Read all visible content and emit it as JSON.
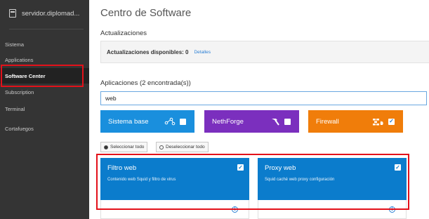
{
  "sidebar": {
    "host_name": "servidor.diplomad...",
    "items": [
      {
        "label": "Sistema"
      },
      {
        "label": "Applications"
      },
      {
        "label": "Software Center"
      },
      {
        "label": "Subscription"
      },
      {
        "label": "Terminal"
      },
      {
        "label": "Cortafuegos"
      }
    ],
    "active_index": 2
  },
  "main": {
    "title": "Centro de Software",
    "updates_heading": "Actualizaciones",
    "updates_text": "Actualizaciones disponibles: 0",
    "updates_link": "Detalles",
    "apps_heading": "Aplicaciones (2 encontrada(s))",
    "search_value": "web",
    "categories": [
      {
        "label": "Sistema base",
        "color": "#1a8fdd",
        "icon": "share-nodes-icon",
        "checked": false
      },
      {
        "label": "NethForge",
        "color": "#7b2fbe",
        "icon": "hammer-icon",
        "checked": false
      },
      {
        "label": "Firewall",
        "color": "#f07d0a",
        "icon": "brick-wall-fire-icon",
        "checked": true
      }
    ],
    "select_all": "Seleccionar todo",
    "deselect_all": "Deseleccionar todo",
    "apps": [
      {
        "title": "Filtro web",
        "description": "Contenido web Squid y filtro de virus",
        "checked": true
      },
      {
        "title": "Proxy web",
        "description": "Squid caché web proxy configuración",
        "checked": true
      }
    ]
  },
  "colors": {
    "sidebar_bg": "#343434",
    "accent_blue": "#0b7ccc",
    "highlight_red": "#e3111a"
  }
}
